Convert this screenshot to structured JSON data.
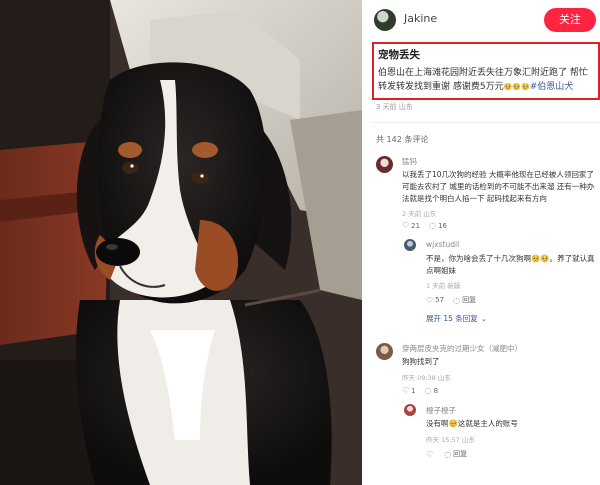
{
  "post": {
    "author": "Jakine",
    "follow_label": "关注",
    "title": "宠物丢失",
    "body": "伯恩山在上海滩花园附近丢失往万象汇附近跑了 帮忙转发转发找到重谢 感谢费5万元",
    "body_emoji": "🥺🥺🥺",
    "tags": "#伯恩山犬",
    "meta": "3 天前  山东",
    "comment_count": "共 142 条评论"
  },
  "comments": [
    {
      "name": "猛犸",
      "text": "以我丢了10几次狗的经验 大概率他现在已经被人领回家了 可能去农村了 城里的话检到的不可能不出来溜 还有一种办法就是找个明白人掐一下 起码找起来有方向",
      "meta": "2 天前  山东",
      "likes": "21",
      "replies_count": "16"
    },
    {
      "name": "wjxstudil",
      "text": "不是，你为啥会丢了十几次狗啊🥺🥺。养了就认真点啊姐妹",
      "meta": "1 天前  新疆",
      "likes": "57",
      "reply_label": "回复"
    },
    {
      "expand_label": "展开 15 条回复"
    },
    {
      "name": "穿两层皮夹克的过期少女（减肥中）",
      "text": "狗狗找到了",
      "meta": "昨天 09:38  山东",
      "likes": "1",
      "replies_count": "8"
    },
    {
      "name": "橙子橙子",
      "text": "没有啊🥺这就是主人的账号",
      "meta": "昨天 15:57  山东",
      "likes": "",
      "reply_label": "回复"
    }
  ]
}
